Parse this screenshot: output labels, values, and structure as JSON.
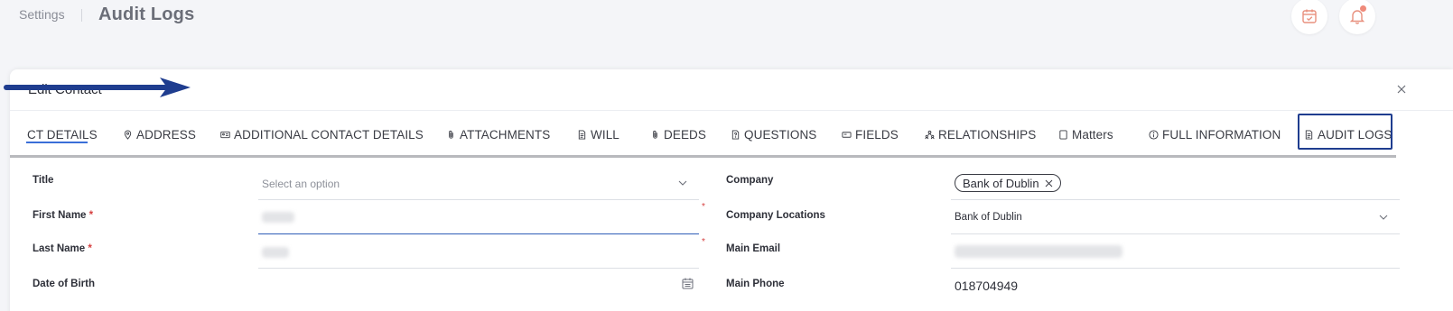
{
  "header": {
    "breadcrumb": "Settings",
    "title": "Audit Logs",
    "icons": [
      "calendar-check-icon",
      "bell-icon"
    ],
    "notification_dot_color": "#ef8a7a"
  },
  "modal": {
    "title": "Edit Contact",
    "close_icon": "close-icon"
  },
  "tabs": [
    {
      "label": "CT DETAILS",
      "icon": "none",
      "active": true
    },
    {
      "label": "ADDRESS",
      "icon": "map-pin-icon"
    },
    {
      "label": "ADDITIONAL CONTACT DETAILS",
      "icon": "id-card-icon"
    },
    {
      "label": "ATTACHMENTS",
      "icon": "paperclip-icon"
    },
    {
      "label": "WILL",
      "icon": "document-icon"
    },
    {
      "label": "DEEDS",
      "icon": "paperclip-icon"
    },
    {
      "label": "QUESTIONS",
      "icon": "question-doc-icon"
    },
    {
      "label": "FIELDS",
      "icon": "fields-icon"
    },
    {
      "label": "RELATIONSHIPS",
      "icon": "people-icon"
    },
    {
      "label": "Matters",
      "icon": "square-icon"
    },
    {
      "label": "FULL INFORMATION",
      "icon": "info-icon"
    },
    {
      "label": "AUDIT LOGS",
      "icon": "document-icon",
      "highlighted": true
    }
  ],
  "annotation": {
    "arrow_color": "#1f3d8f",
    "highlight_color": "#1f3d8f"
  },
  "form": {
    "left": [
      {
        "label": "Title",
        "required": false,
        "value": "",
        "placeholder": "Select an option",
        "type": "select"
      },
      {
        "label": "First Name",
        "required": true,
        "value": "",
        "type": "text",
        "redacted": true
      },
      {
        "label": "Last Name",
        "required": true,
        "value": "",
        "type": "text",
        "redacted": true
      },
      {
        "label": "Date of Birth",
        "required": false,
        "value": "",
        "type": "date"
      }
    ],
    "right": [
      {
        "label": "Company",
        "type": "chips",
        "chips": [
          "Bank of Dublin"
        ]
      },
      {
        "label": "Company Locations",
        "type": "select",
        "value": "Bank of Dublin"
      },
      {
        "label": "Main Email",
        "type": "text",
        "redacted": true
      },
      {
        "label": "Main Phone",
        "type": "text",
        "value": "018704949"
      }
    ],
    "required_marker": "*"
  }
}
